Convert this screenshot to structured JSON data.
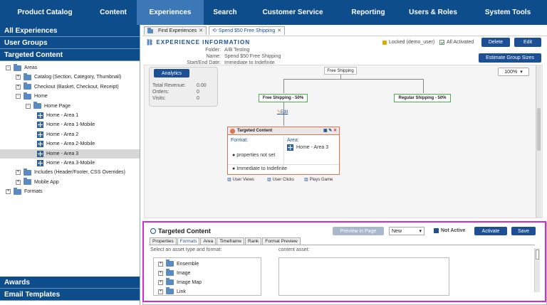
{
  "nav": [
    {
      "label": "Product Catalog",
      "active": false
    },
    {
      "label": "Content",
      "active": false
    },
    {
      "label": "Experiences",
      "active": true
    },
    {
      "label": "Search",
      "active": false
    },
    {
      "label": "Customer Service",
      "active": false
    },
    {
      "label": "Reporting",
      "active": false
    },
    {
      "label": "Users & Roles",
      "active": false
    },
    {
      "label": "System Tools",
      "active": false
    }
  ],
  "sidebar": {
    "sections": [
      "All Experiences",
      "User Groups",
      "Targeted Content"
    ],
    "tree": [
      {
        "label": "Areas",
        "expander": "-",
        "icon": "folder"
      },
      {
        "label": "Catalog (Section, Category, Thumbnail)",
        "expander": "+",
        "icon": "folder"
      },
      {
        "label": "Checkout (Basket, Checkout, Receipt)",
        "expander": "+",
        "icon": "folder"
      },
      {
        "label": "Home",
        "expander": "-",
        "icon": "folder"
      },
      {
        "label": "Home Page",
        "expander": "-",
        "icon": "folder"
      },
      {
        "label": "Home - Area 1",
        "expander": "",
        "icon": "page"
      },
      {
        "label": "Home - Area 1-Mobile",
        "expander": "",
        "icon": "page"
      },
      {
        "label": "Home - Area 2",
        "expander": "",
        "icon": "page"
      },
      {
        "label": "Home - Area 2-Mobile",
        "expander": "",
        "icon": "page"
      },
      {
        "label": "Home - Area 3",
        "expander": "",
        "icon": "page",
        "selected": true
      },
      {
        "label": "Home - Area 3-Mobile",
        "expander": "",
        "icon": "page"
      },
      {
        "label": "Includes (Header/Footer, CSS Overrides)",
        "expander": "+",
        "icon": "folder"
      },
      {
        "label": "Mobile App",
        "expander": "+",
        "icon": "folder"
      },
      {
        "label": "Formats",
        "expander": "+",
        "icon": "folder"
      }
    ],
    "bottom": [
      "Awards",
      "Email Templates"
    ]
  },
  "tabs": [
    {
      "label": "Find Experiences",
      "active": false
    },
    {
      "label": "Spend $50 Free Shipping",
      "active": true
    }
  ],
  "info": {
    "title": "EXPERIENCE INFORMATION",
    "folder_label": "Folder:",
    "folder_value": "A/B Testing",
    "name_label": "Name:",
    "name_value": "Spend $50 Free Shipping",
    "dates_label": "Start/End Date:",
    "dates_value": "Immediate to Indefinite",
    "locked": "Locked (demo_user)",
    "all_activated": "All Activated",
    "delete": "Delete",
    "edit": "Edit",
    "estimate": "Estimate Group Sizes"
  },
  "canvas": {
    "analytics": "Analytics",
    "revenue_label": "Total Revenue:",
    "revenue_value": "0.00",
    "orders_label": "Orders:",
    "orders_value": "0",
    "visits_label": "Visits:",
    "visits_value": "0",
    "zoom": "100%",
    "root": "Free Shipping",
    "branch_a": "Free Shipping - 50%",
    "branch_b": "Regular Shipping - 50%",
    "edit_link": "Edit",
    "tc_title": "Targeted Content",
    "format_label": "Format:",
    "area_label": "Area:",
    "area_value": "Home - Area 3",
    "props": "properties not set",
    "schedule": "Immediate to Indefinite",
    "user_views": "User Views",
    "user_clicks": "User Clicks",
    "plays_game": "Plays Game"
  },
  "panel": {
    "title": "Targeted Content",
    "preview": "Preview in Page",
    "status_select": "New",
    "not_active": "Not Active",
    "activate": "Activate",
    "save": "Save",
    "subtabs": [
      "Properties",
      "Formats",
      "Area",
      "Timeframe",
      "Rank",
      "Format Preview"
    ],
    "active_subtab": "Formats",
    "select_text": "Select an asset type and format:",
    "content_asset": "content asset:",
    "types": [
      "Ensemble",
      "Image",
      "Image Map",
      "Link"
    ]
  },
  "colors": {
    "nav": "#0e4d8c",
    "nav_active": "#3c78b8",
    "accent": "#1c4f94",
    "highlight": "#d22bd2"
  }
}
